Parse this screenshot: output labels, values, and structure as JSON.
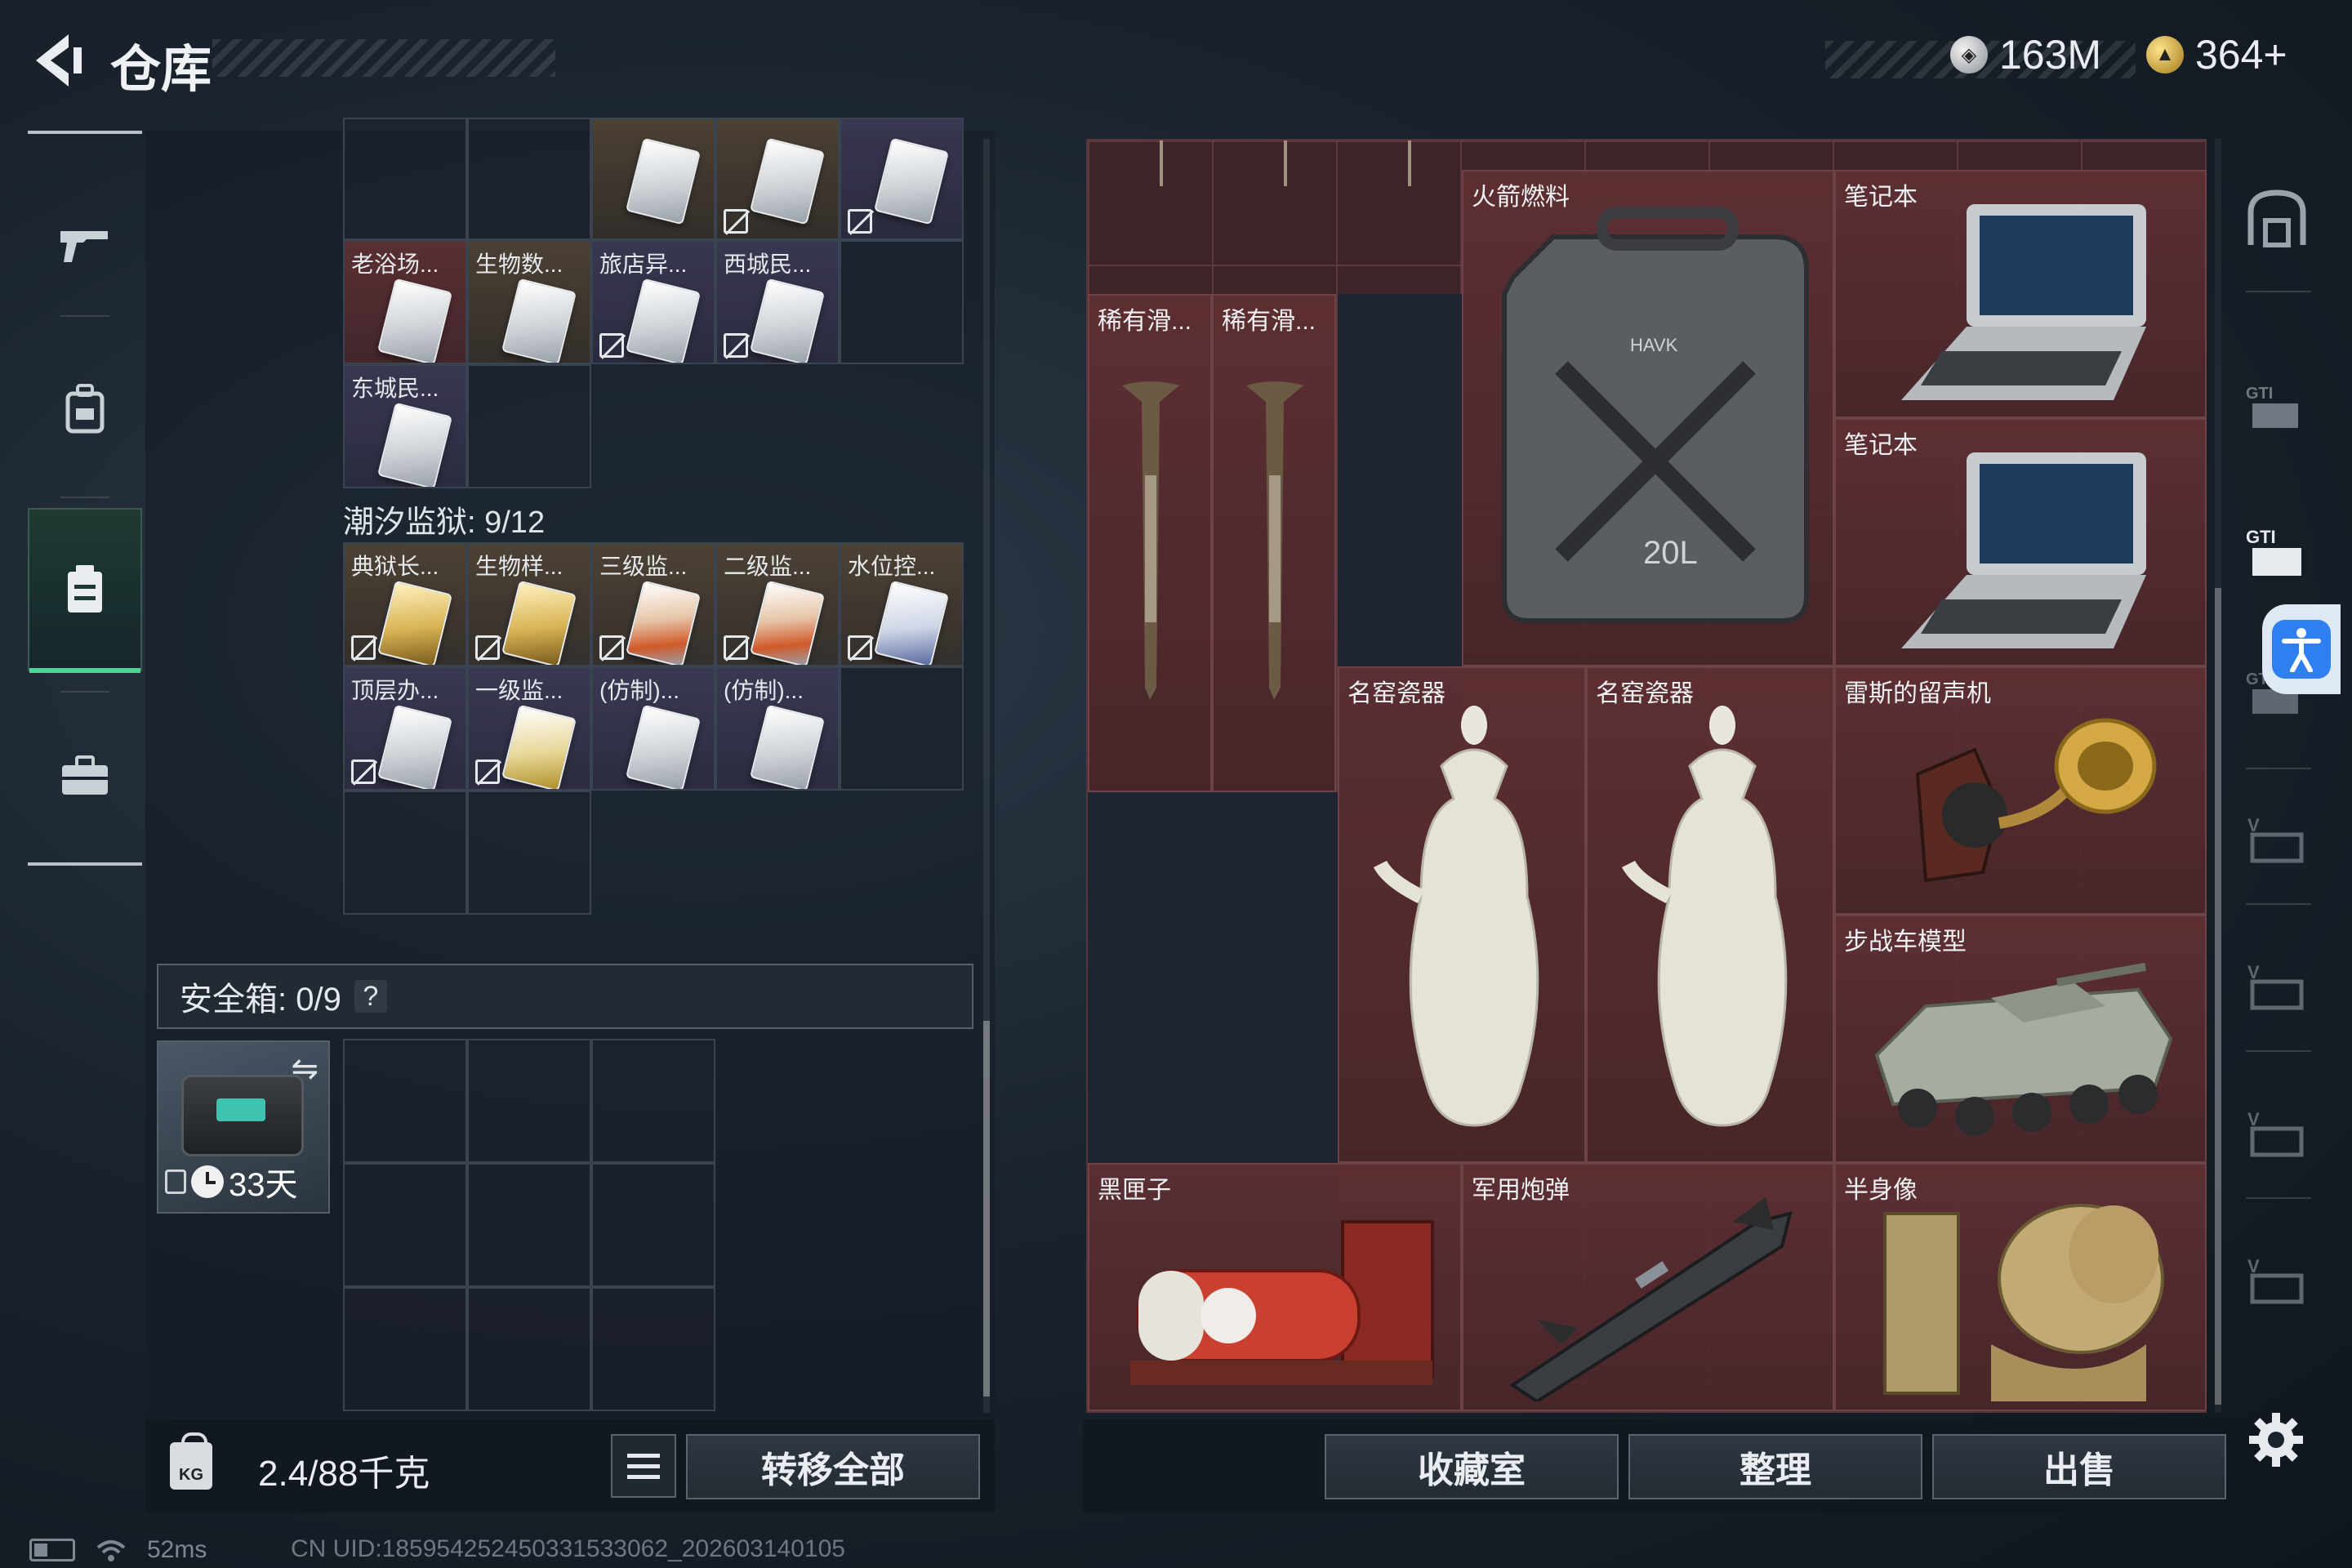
{
  "header": {
    "title": "仓库",
    "currency_silver": "163M",
    "currency_gold": "364+"
  },
  "left_rail": {
    "items": [
      {
        "icon": "gun-icon"
      },
      {
        "icon": "backpack-icon"
      },
      {
        "icon": "storage-icon",
        "active": true
      },
      {
        "icon": "toolbox-icon"
      }
    ]
  },
  "keycards_top": {
    "row1": [
      "",
      "",
      "",
      "",
      ""
    ],
    "row2": [
      "老浴场...",
      "生物数...",
      "旅店异...",
      "西城民...",
      ""
    ],
    "row3": [
      "东城民..."
    ]
  },
  "tide_prison": {
    "title": "潮汐监狱: 9/12",
    "row1": [
      "典狱长...",
      "生物样...",
      "三级监...",
      "二级监...",
      "水位控..."
    ],
    "row2": [
      "顶层办...",
      "一级监...",
      "(仿制)...",
      "(仿制)..."
    ]
  },
  "safebox": {
    "label": "安全箱: 0/9",
    "help": "?",
    "days": "33天"
  },
  "footer_left": {
    "weight": "2.4/88千克",
    "transfer_all": "转移全部"
  },
  "stash_items": {
    "rare_1": "稀有滑...",
    "rare_2": "稀有滑...",
    "fuel": "火箭燃料",
    "fuel_can_text": "20L",
    "fuel_brand": "HAVK",
    "laptop_1": "笔记本",
    "laptop_2": "笔记本",
    "porcelain_1": "名窑瓷器",
    "porcelain_2": "名窑瓷器",
    "gramophone": "雷斯的留声机",
    "ifv_model": "步战车模型",
    "black_box": "黑匣子",
    "shell": "军用炮弹",
    "bust": "半身像"
  },
  "footer_right": {
    "collection": "收藏室",
    "sort": "整理",
    "sell": "出售"
  },
  "status_bar": {
    "ping": "52ms",
    "uid": "CN UID:1859542524503315330​62_202603140105"
  }
}
